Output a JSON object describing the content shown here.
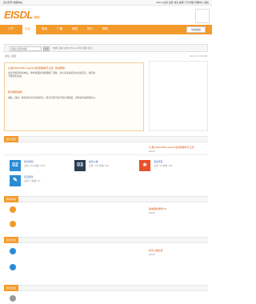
{
  "topbar": {
    "left_text": "设为首页  收藏本站",
    "right_text": "admin  在线  设置  消息  提醒  门户管理  管理中心  退出"
  },
  "logo": {
    "main": "EISDL",
    "sub": "论坛"
  },
  "nav": {
    "items": [
      "门户",
      "论坛",
      "群组",
      "广播",
      "家园",
      "排行",
      "帮助",
      "读"
    ],
    "active_index": 1,
    "button": "快速发帖"
  },
  "search": {
    "placeholder": "请输入搜索内容",
    "button": "搜索",
    "hot": "热搜: 活动 交友 iPhone 手机 游戏 论坛"
  },
  "breadcrumb": "论坛 › 论坛",
  "announce": {
    "title1": "[公告] 2012 ISDL Legend 论坛新版本已上线，欢迎体验！",
    "body1": "论坛升级到新版本后，整体界面和功能都做了调整，请大家多多留意并反馈意见，我们会不断优化改进。",
    "title2": "积分规则说明",
    "body2": "发帖、回帖、参加活动均可获得积分，积分可用于提升用户组等级，详情请查看帮助中心。"
  },
  "sections": [
    {
      "tab": "官方专区",
      "forums": [
        {
          "icon": "02",
          "color": "#2a8bd6",
          "name": "官方新闻",
          "stats": "主题: 301  帖数: 3021"
        },
        {
          "icon": "03",
          "color": "#2c3e55",
          "name": "站务公告",
          "stats": "主题: 150  帖数: 902"
        },
        {
          "icon": "★",
          "color": "#e8502a",
          "name": "活动专区",
          "stats": "主题: 88  帖数: 520"
        },
        {
          "icon": "✎",
          "color": "#2a8bd6",
          "name": "意见建议",
          "stats": "主题: 5  帖数: 20"
        }
      ]
    },
    {
      "tab": "娱乐频道"
    },
    {
      "tab": "综合讨论"
    },
    {
      "tab": "技术交流"
    }
  ],
  "latest": [
    "[公告] 2012 ISDL Legend 论坛新版本已上线",
    "版本更新说明 2.0",
    "新手上路必读"
  ],
  "admin": "admin",
  "date": "2012-7-13 10:05"
}
